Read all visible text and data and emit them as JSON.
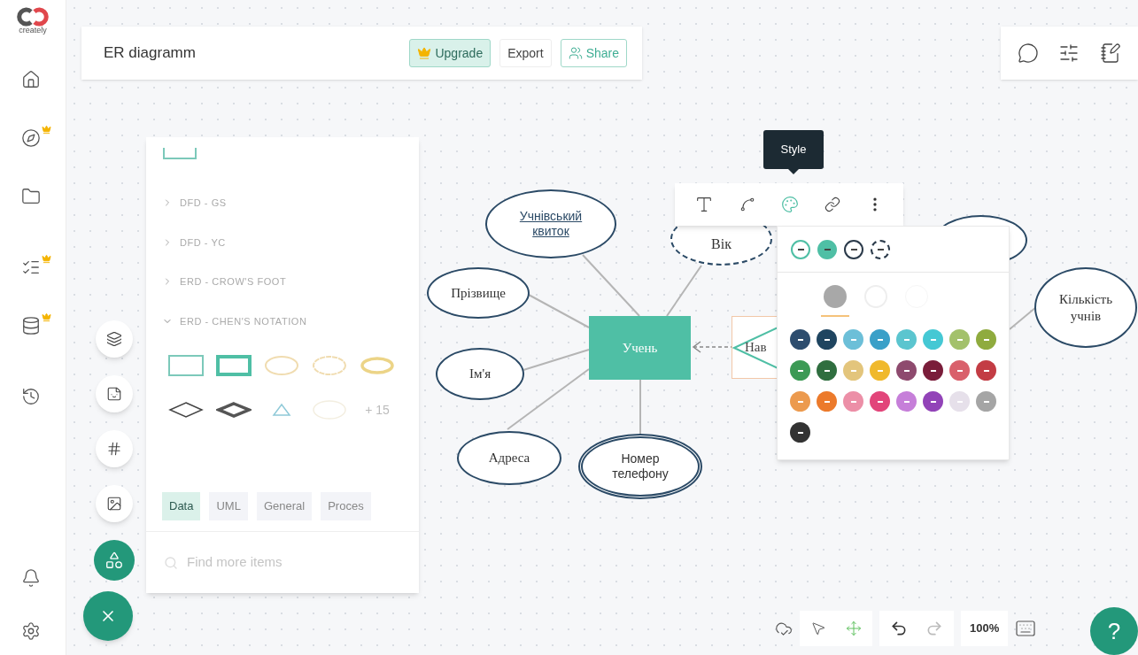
{
  "sidebar": {
    "logo_text": "creately",
    "items": [
      {
        "kind": "home",
        "premium": false
      },
      {
        "kind": "compass",
        "premium": true
      },
      {
        "kind": "folder",
        "premium": false
      },
      {
        "kind": "list",
        "premium": true
      },
      {
        "kind": "database",
        "premium": true
      },
      {
        "kind": "history",
        "premium": false
      }
    ],
    "bottom_items": [
      {
        "kind": "bell"
      },
      {
        "kind": "settings"
      }
    ]
  },
  "header": {
    "title": "ER diagramm",
    "buttons": [
      {
        "kind": "upgrade",
        "label": "Upgrade"
      },
      {
        "kind": "export",
        "label": "Export"
      },
      {
        "kind": "share",
        "label": "Share"
      }
    ]
  },
  "shape_panel": {
    "categories": [
      {
        "label": "DFD - GS",
        "expanded": false
      },
      {
        "label": "DFD - YC",
        "expanded": false
      },
      {
        "label": "ERD - CROW'S FOOT",
        "expanded": false
      },
      {
        "label": "ERD - CHEN'S NOTATION",
        "expanded": true
      }
    ],
    "more_count": "+ 15",
    "tabs": [
      {
        "label": "Data",
        "selected": true
      },
      {
        "label": "UML",
        "selected": false
      },
      {
        "label": "General",
        "selected": false
      },
      {
        "label": "Proces",
        "selected": false
      }
    ],
    "search": {
      "placeholder": "Find more items"
    }
  },
  "diagram": {
    "nodes": [
      {
        "kind": "key-attribute",
        "label": "Учнівський квиток"
      },
      {
        "kind": "derived-attribute",
        "label": "Вік"
      },
      {
        "kind": "attribute",
        "label": "Прізвище"
      },
      {
        "kind": "entity",
        "label": "Учень"
      },
      {
        "kind": "attribute",
        "label": "Ім'я"
      },
      {
        "kind": "attribute",
        "label": "Адреса"
      },
      {
        "kind": "multivalued-attribute",
        "label": "Номер телефону"
      },
      {
        "kind": "relationship",
        "label": "Нав"
      },
      {
        "kind": "attribute"
      },
      {
        "kind": "attribute",
        "label": "Кількість учнів"
      }
    ]
  },
  "context_toolbar": {
    "tooltip": "Style"
  },
  "style_panel": {
    "styles": [
      {
        "kind": "outline"
      },
      {
        "kind": "filled"
      },
      {
        "kind": "dark-outline"
      },
      {
        "kind": "dashed"
      }
    ],
    "fills": [
      {
        "kind": "solid",
        "selected": true
      },
      {
        "kind": "outline",
        "selected": false
      },
      {
        "kind": "none",
        "selected": false
      }
    ],
    "swatches": [
      {
        "color": "#2d4d6e"
      },
      {
        "color": "#1f4560"
      },
      {
        "color": "#6cbfd8"
      },
      {
        "color": "#3aa0c8"
      },
      {
        "color": "#5bc5cf"
      },
      {
        "color": "#45c8d4"
      },
      {
        "color": "#a3c16b"
      },
      {
        "color": "#8fab3e"
      },
      {
        "color": "#3c9a55"
      },
      {
        "color": "#2f6e3f"
      },
      {
        "color": "#e3c57c"
      },
      {
        "color": "#f0b92c"
      },
      {
        "color": "#8e4a6e"
      },
      {
        "color": "#7a1d3a"
      },
      {
        "color": "#d9606b"
      },
      {
        "color": "#c33c44"
      },
      {
        "color": "#ec9a4e"
      },
      {
        "color": "#ec7a2b"
      },
      {
        "color": "#ec8fa7"
      },
      {
        "color": "#e2457a"
      },
      {
        "color": "#c67fd9"
      },
      {
        "color": "#9243b8"
      },
      {
        "color": "#e6e0ea"
      },
      {
        "color": "#a5a5a5"
      },
      {
        "color": "#333333"
      }
    ]
  },
  "bottom_bar": {
    "zoom": "100%",
    "help": "?"
  }
}
